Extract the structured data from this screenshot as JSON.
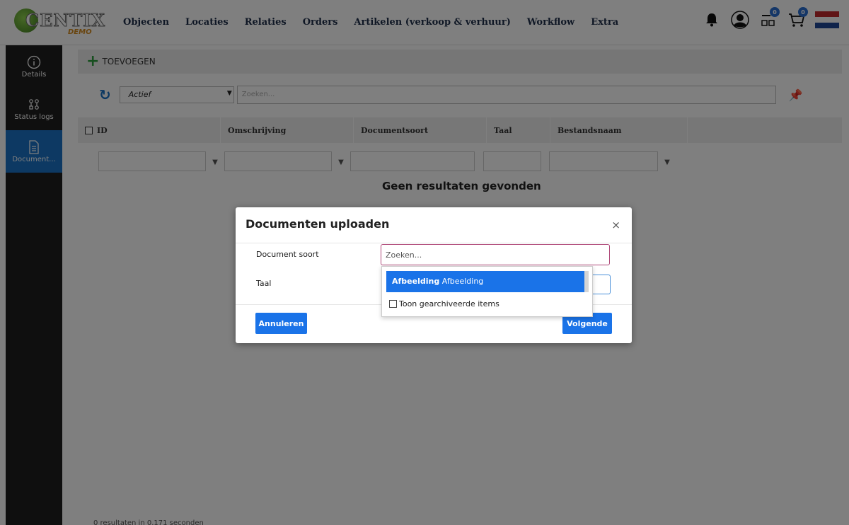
{
  "brand": {
    "name": "CENTIX",
    "sub": "DEMO"
  },
  "nav": [
    "Objecten",
    "Locaties",
    "Relaties",
    "Orders",
    "Artikelen (verkoop & verhuur)",
    "Workflow",
    "Extra"
  ],
  "badges": {
    "scan": "0",
    "cart": "0"
  },
  "colors": {
    "accent": "#1a73e8",
    "sidebar": "#1e1e1e",
    "active": "#1a73c6",
    "add": "#2e9e3e"
  },
  "sidebar": [
    {
      "label": "Details",
      "icon": "info-icon"
    },
    {
      "label": "Status logs",
      "icon": "status-logs-icon"
    },
    {
      "label": "Document...",
      "icon": "document-icon"
    }
  ],
  "toolbar": {
    "add_label": "TOEVOEGEN"
  },
  "filter": {
    "status": "Actief",
    "search_placeholder": "Zoeken..."
  },
  "table": {
    "columns": [
      "ID",
      "Omschrijving",
      "Documentsoort",
      "Taal",
      "Bestandsnaam"
    ],
    "empty": "Geen resultaten gevonden",
    "footer": "0 resultaten in 0.171 seconden"
  },
  "modal": {
    "title": "Documenten uploaden",
    "close": "×",
    "fields": {
      "doc_type": "Document soort",
      "language": "Taal"
    },
    "cancel": "Annuleren",
    "next": "Volgende"
  },
  "dropdown": {
    "placeholder": "Zoeken...",
    "option_bold": "Afbeelding",
    "option_rest": "Afbeelding",
    "archive": "Toon gearchiveerde items"
  }
}
